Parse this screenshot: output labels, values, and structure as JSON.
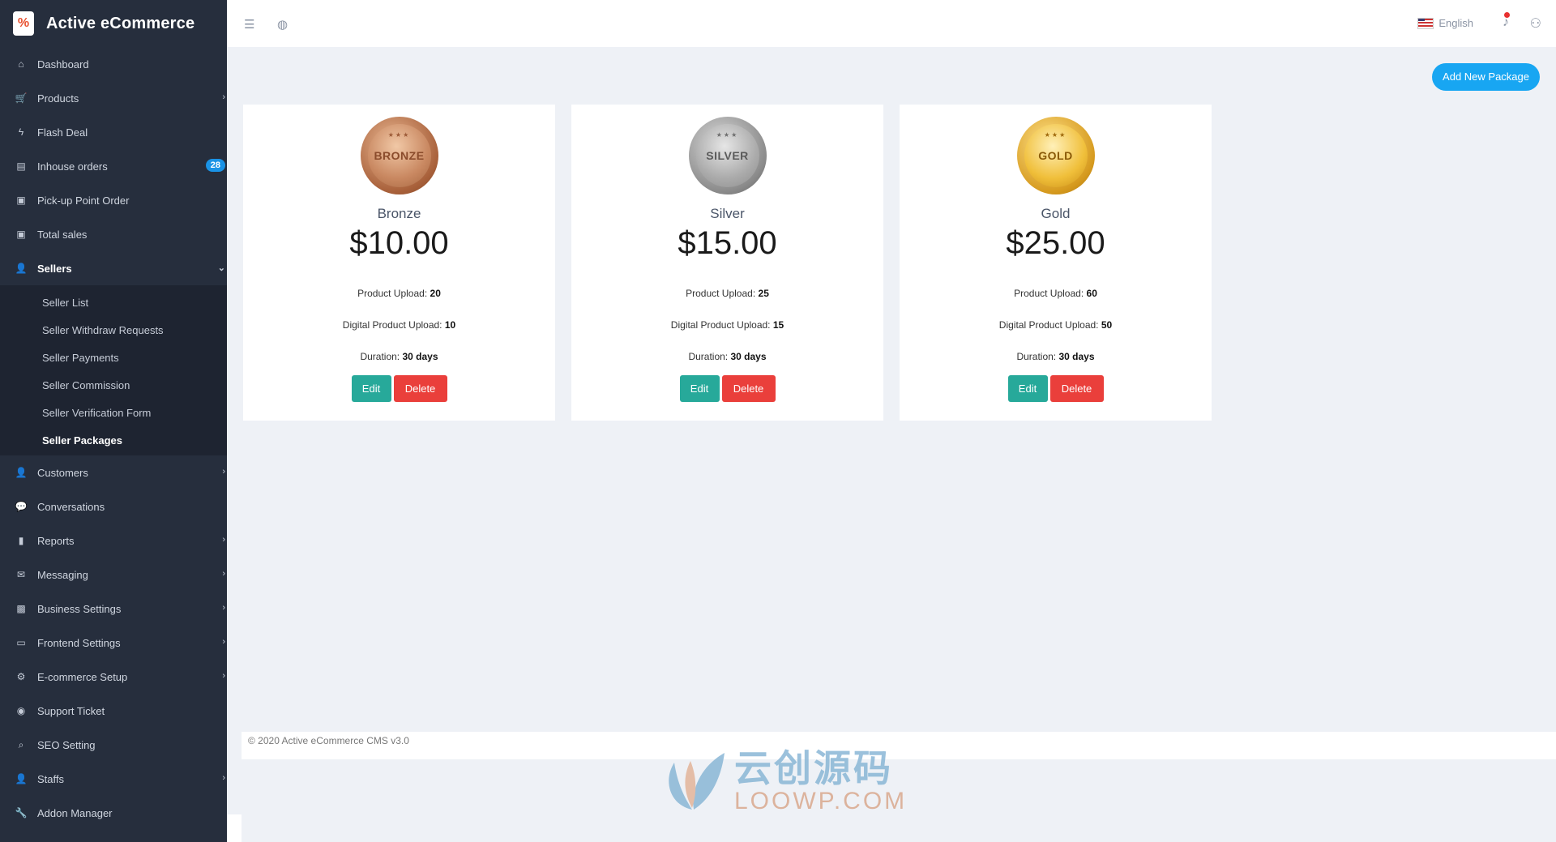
{
  "brand": {
    "name": "Active eCommerce"
  },
  "sidebar": {
    "items": [
      {
        "label": "Dashboard",
        "icon": "home-icon",
        "glyph": "⌂"
      },
      {
        "label": "Products",
        "icon": "cart-icon",
        "glyph": "🛒",
        "arrow": "›"
      },
      {
        "label": "Flash Deal",
        "icon": "bolt-icon",
        "glyph": "ϟ"
      },
      {
        "label": "Inhouse orders",
        "icon": "basket-icon",
        "glyph": "▤",
        "badge": "28"
      },
      {
        "label": "Pick-up Point Order",
        "icon": "money-icon",
        "glyph": "▣"
      },
      {
        "label": "Total sales",
        "icon": "money-icon",
        "glyph": "▣"
      },
      {
        "label": "Sellers",
        "icon": "user-plus-icon",
        "glyph": "👤",
        "arrow": "⌄"
      }
    ],
    "seller_sub": [
      "Seller List",
      "Seller Withdraw Requests",
      "Seller Payments",
      "Seller Commission",
      "Seller Verification Form",
      "Seller Packages"
    ],
    "items_after": [
      {
        "label": "Customers",
        "icon": "user-plus-icon",
        "glyph": "👤",
        "arrow": "›"
      },
      {
        "label": "Conversations",
        "icon": "chat-icon",
        "glyph": "💬"
      },
      {
        "label": "Reports",
        "icon": "file-icon",
        "glyph": "▮",
        "arrow": "›"
      },
      {
        "label": "Messaging",
        "icon": "envelope-icon",
        "glyph": "✉",
        "arrow": "›"
      },
      {
        "label": "Business Settings",
        "icon": "briefcase-icon",
        "glyph": "▩",
        "arrow": "›"
      },
      {
        "label": "Frontend Settings",
        "icon": "desktop-icon",
        "glyph": "▭",
        "arrow": "›"
      },
      {
        "label": "E-commerce Setup",
        "icon": "gear-icon",
        "glyph": "⚙",
        "arrow": "›"
      },
      {
        "label": "Support Ticket",
        "icon": "globe-icon",
        "glyph": "◉"
      },
      {
        "label": "SEO Setting",
        "icon": "search-icon",
        "glyph": "⌕"
      },
      {
        "label": "Staffs",
        "icon": "user-icon",
        "glyph": "👤",
        "arrow": "›"
      },
      {
        "label": "Addon Manager",
        "icon": "wrench-icon",
        "glyph": "🔧"
      }
    ]
  },
  "topbar": {
    "language": "English"
  },
  "page": {
    "add_button": "Add New Package"
  },
  "packages": [
    {
      "medal": "BRONZE",
      "name": "Bronze",
      "price": "$10.00",
      "product_upload": "20",
      "digital_upload": "10",
      "duration": "30 days"
    },
    {
      "medal": "SILVER",
      "name": "Silver",
      "price": "$15.00",
      "product_upload": "25",
      "digital_upload": "15",
      "duration": "30 days"
    },
    {
      "medal": "GOLD",
      "name": "Gold",
      "price": "$25.00",
      "product_upload": "60",
      "digital_upload": "50",
      "duration": "30 days"
    }
  ],
  "labels": {
    "product_upload": "Product Upload:",
    "digital_upload": "Digital Product Upload:",
    "duration": "Duration:",
    "edit": "Edit",
    "delete": "Delete"
  },
  "footer": {
    "text": "© 2020 Active eCommerce CMS v3.0"
  },
  "watermark": {
    "cn": "云创源码",
    "en": "LOOWP.COM"
  },
  "colors": {
    "sidebar": "#262e3d",
    "accent": "#18a6f2",
    "edit": "#27a99a",
    "delete": "#ea3f3b",
    "badge": "#1a93e6"
  }
}
